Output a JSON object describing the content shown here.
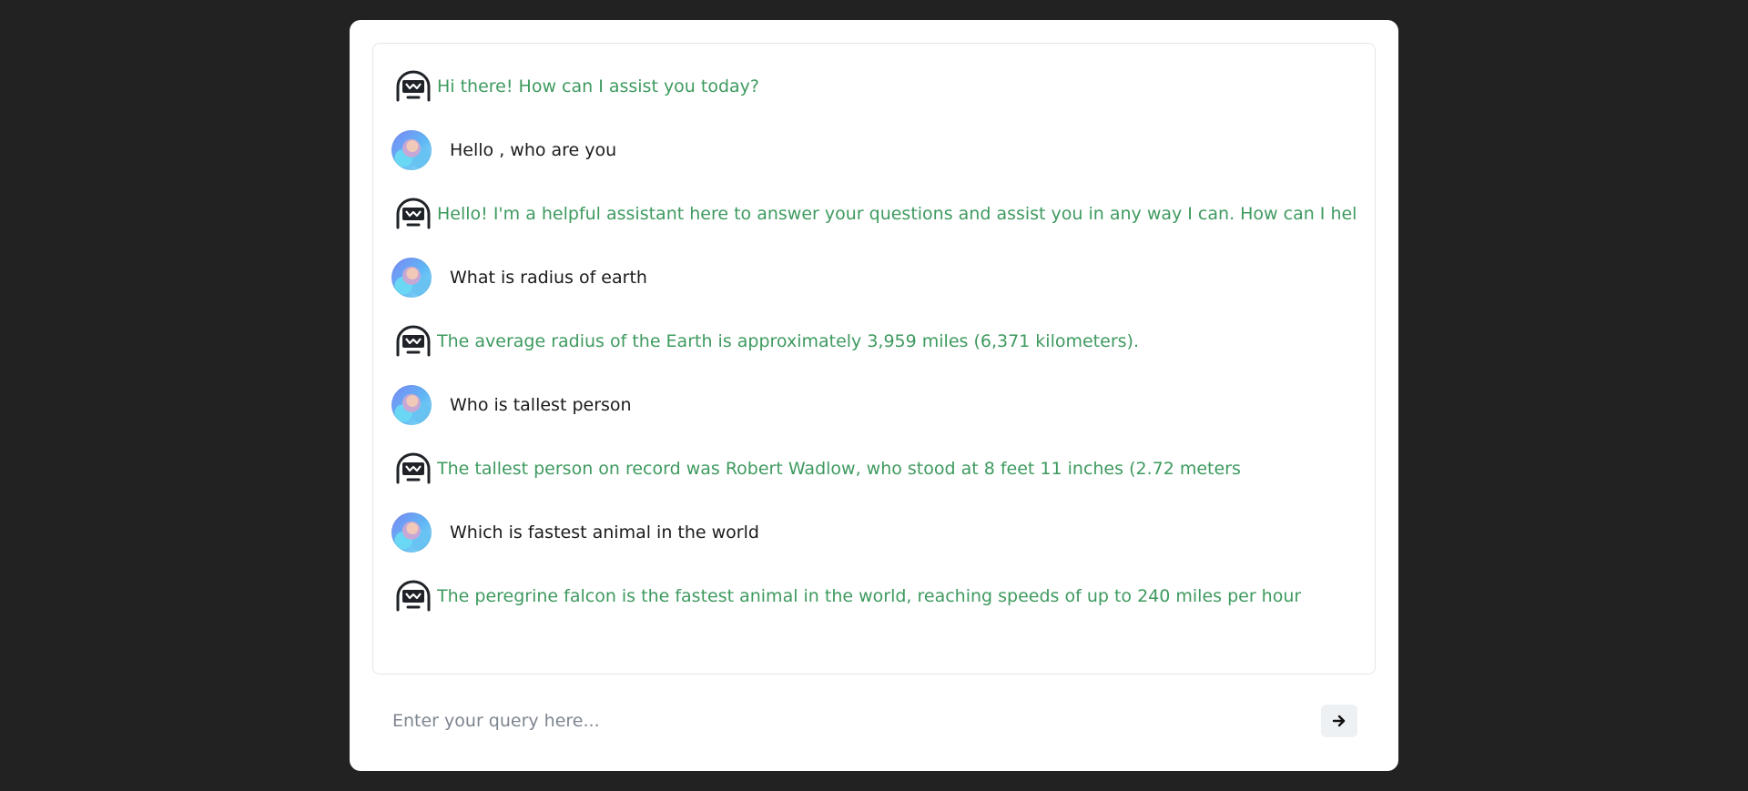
{
  "colors": {
    "page_background": "#222222",
    "card_background": "#ffffff",
    "bot_text": "#3e9a5f",
    "user_text": "#1b1b1b",
    "placeholder": "#7d8590",
    "send_button_bg": "#eef1f4"
  },
  "chat": {
    "messages": [
      {
        "role": "bot",
        "icon": "robot-face-icon",
        "text": "Hi there! How can I assist you today?"
      },
      {
        "role": "user",
        "icon": "user-avatar",
        "text": "Hello , who are you"
      },
      {
        "role": "bot",
        "icon": "robot-face-icon",
        "text": "Hello! I'm a helpful assistant here to answer your questions and assist you in any way I can. How can I help"
      },
      {
        "role": "user",
        "icon": "user-avatar",
        "text": "What is radius of earth"
      },
      {
        "role": "bot",
        "icon": "robot-face-icon",
        "text": "The average radius of the Earth is approximately 3,959 miles (6,371 kilometers)."
      },
      {
        "role": "user",
        "icon": "user-avatar",
        "text": "Who is tallest person"
      },
      {
        "role": "bot",
        "icon": "robot-face-icon",
        "text": "The tallest person on record was Robert Wadlow, who stood at 8 feet 11 inches (2.72 meters"
      },
      {
        "role": "user",
        "icon": "user-avatar",
        "text": "Which is fastest animal in the world"
      },
      {
        "role": "bot",
        "icon": "robot-face-icon",
        "text": "The peregrine falcon is the fastest animal in the world, reaching speeds of up to 240 miles per hour"
      }
    ]
  },
  "composer": {
    "placeholder": "Enter your query here...",
    "value": "",
    "send_icon": "arrow-right-icon"
  }
}
